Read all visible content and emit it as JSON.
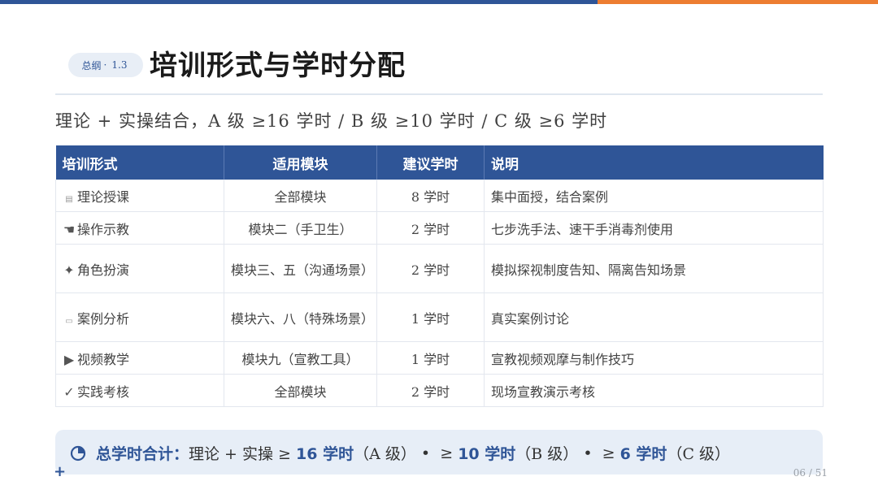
{
  "header": {
    "badge_section": "总纲",
    "badge_sep": "·",
    "badge_number": "1.3",
    "title": "培训形式与学时分配"
  },
  "subtitle": "理论 + 实操结合，A 级 ≥16 学时 / B 级 ≥10 学时 / C 级 ≥6 学时",
  "table": {
    "headers": [
      "培训形式",
      "适用模块",
      "建议学时",
      "说明"
    ],
    "rows": [
      {
        "icon": "document-icon",
        "glyph": "▤",
        "form": "理论授课",
        "module": "全部模块",
        "hours": "8 学时",
        "desc": "集中面授，结合案例"
      },
      {
        "icon": "hand-pointer-icon",
        "glyph": "☚",
        "form": "操作示教",
        "module": "模块二（手卫生）",
        "hours": "2 学时",
        "desc": "七步洗手法、速干手消毒剂使用"
      },
      {
        "icon": "sparkle-icon",
        "glyph": "✦",
        "form": "角色扮演",
        "module": "模块三、五（沟通场景）",
        "hours": "2 学时",
        "desc": "模拟探视制度告知、隔离告知场景"
      },
      {
        "icon": "folder-icon",
        "glyph": "▭",
        "form": "案例分析",
        "module": "模块六、八（特殊场景）",
        "hours": "1 学时",
        "desc": "真实案例讨论"
      },
      {
        "icon": "play-icon",
        "glyph": "▶",
        "form": "视频教学",
        "module": "模块九（宣教工具）",
        "hours": "1 学时",
        "desc": "宣教视频观摩与制作技巧"
      },
      {
        "icon": "check-icon",
        "glyph": "✓",
        "form": "实践考核",
        "module": "全部模块",
        "hours": "2 学时",
        "desc": "现场宣教演示考核"
      }
    ]
  },
  "summary": {
    "label": "总学时合计：",
    "lead": "理论 + 实操 ≥",
    "a_hours": "16 学时",
    "a_level": "（A 级）",
    "dot1": "•",
    "b_prefix": "≥",
    "b_hours": "10 学时",
    "b_level": "（B 级）",
    "dot2": "•",
    "c_prefix": "≥",
    "c_hours": "6 学时",
    "c_level": "（C 级）"
  },
  "footer": {
    "plus": "+",
    "page": "06 / 51"
  },
  "colors": {
    "primary": "#2f5597",
    "accent": "#ed7d31",
    "summary_bg": "#e7eef7"
  }
}
